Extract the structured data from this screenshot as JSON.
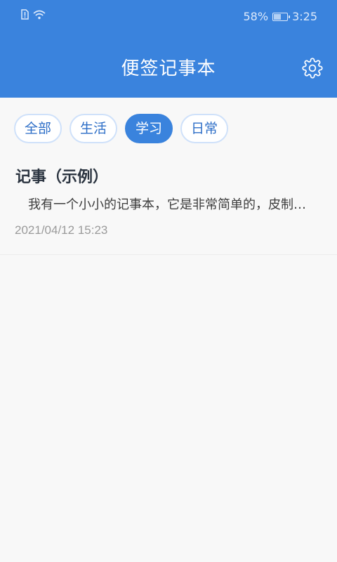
{
  "status_bar": {
    "battery_percent": "58%",
    "battery_level": 0.58,
    "time": "3:25",
    "icons": [
      "sim-alert-icon",
      "wifi-icon",
      "battery-icon"
    ]
  },
  "header": {
    "title": "便签记事本",
    "settings_icon": "gear-icon",
    "background_color": "#3a83dd"
  },
  "tabs": [
    {
      "label": "全部",
      "active": false
    },
    {
      "label": "生活",
      "active": false
    },
    {
      "label": "学习",
      "active": true
    },
    {
      "label": "日常",
      "active": false
    }
  ],
  "notes": [
    {
      "title": "记事（示例）",
      "preview": "　我有一个小小的记事本，它是非常简单的，皮制…",
      "datetime": "2021/04/12 15:23"
    }
  ]
}
